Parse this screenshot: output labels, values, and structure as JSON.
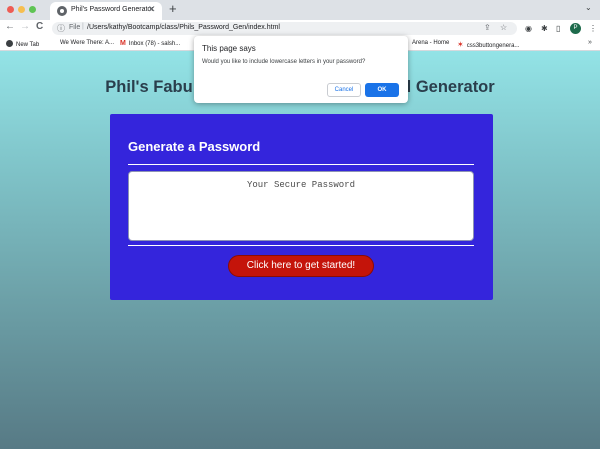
{
  "browser": {
    "tab_title": "Phil's Password Generator",
    "url_scheme": "File",
    "url": "/Users/kathy/Bootcamp/class/Phils_Password_Gen/index.html",
    "profile_initial": "P",
    "bookmarks": [
      {
        "label": "New Tab"
      },
      {
        "label": "We Were There: A..."
      },
      {
        "label": "Inbox (78) - salsh..."
      },
      {
        "label": "Arena - Home"
      },
      {
        "label": "css3buttongenera..."
      }
    ]
  },
  "page": {
    "heading_left": "Phil's Fabu",
    "heading_right": "l Generator",
    "card_title": "Generate a Password",
    "password_placeholder": "Your Secure Password",
    "generate_button": "Click here to get started!"
  },
  "dialog": {
    "title": "This page says",
    "message": "Would you like to include lowercase letters in your password?",
    "cancel_label": "Cancel",
    "ok_label": "OK"
  },
  "colors": {
    "card_bg": "#3425dc",
    "button_bg": "#c4140a",
    "dialog_ok": "#1a73e8"
  }
}
